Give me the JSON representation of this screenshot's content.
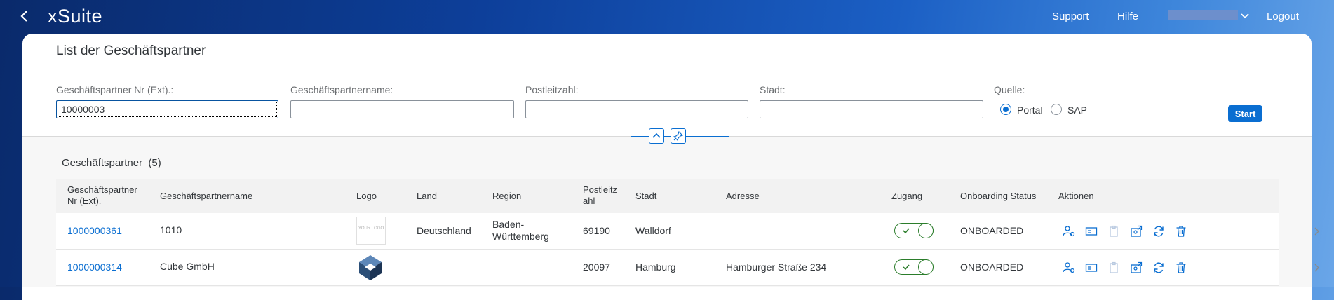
{
  "app": {
    "brand": "xSuite"
  },
  "topbar": {
    "support": "Support",
    "hilfe": "Hilfe",
    "logout": "Logout"
  },
  "page": {
    "title": "List der Geschäftspartner"
  },
  "filters": {
    "partner_nr_label": "Geschäftspartner Nr (Ext).:",
    "partner_nr_value": "10000003",
    "name_label": "Geschäftspartnername:",
    "plz_label": "Postleitzahl:",
    "stadt_label": "Stadt:",
    "quelle_label": "Quelle:",
    "quelle_options": [
      "Portal",
      "SAP"
    ],
    "quelle_selected": "Portal",
    "start_label": "Start"
  },
  "table": {
    "title": "Geschäftspartner",
    "count": "(5)",
    "columns": {
      "nr": [
        "Geschäftspartner",
        "Nr (Ext)."
      ],
      "name": "Geschäftspartnername",
      "logo": "Logo",
      "land": "Land",
      "region": "Region",
      "plz": [
        "Postleitz",
        "ahl"
      ],
      "stadt": "Stadt",
      "adresse": "Adresse",
      "zugang": "Zugang",
      "status": "Onboarding Status",
      "aktionen": "Aktionen"
    },
    "rows": [
      {
        "nr": "1000000361",
        "name": "1010",
        "logo_text": "YOUR LOGO",
        "land": "Deutschland",
        "region": [
          "Baden-",
          "Württemberg"
        ],
        "plz": "69190",
        "stadt": "Walldorf",
        "adresse": "",
        "zugang": true,
        "status": "ONBOARDED"
      },
      {
        "nr": "1000000314",
        "name": "Cube GmbH",
        "logo_text": "",
        "land": "",
        "region": [
          "",
          ""
        ],
        "plz": "20097",
        "stadt": "Hamburg",
        "adresse": "Hamburger Straße 234",
        "zugang": true,
        "status": "ONBOARDED"
      }
    ]
  },
  "colors": {
    "accent": "#0a6ed1",
    "toggle_on": "#2b7d2b"
  }
}
